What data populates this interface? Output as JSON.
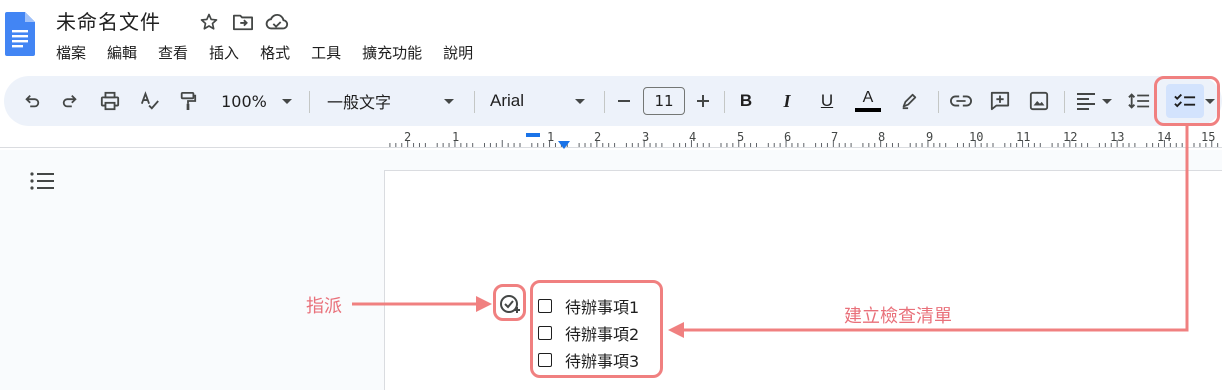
{
  "document": {
    "title": "未命名文件",
    "menu": [
      "檔案",
      "編輯",
      "查看",
      "插入",
      "格式",
      "工具",
      "擴充功能",
      "說明"
    ]
  },
  "toolbar": {
    "zoom": "100%",
    "paragraph_style": "一般文字",
    "font": "Arial",
    "font_size": "11",
    "bold_label": "B",
    "italic_label": "I",
    "underline_label": "U",
    "text_color_label": "A"
  },
  "ruler": {
    "labels": [
      "2",
      "1",
      "1",
      "2",
      "3",
      "4",
      "5",
      "6",
      "7",
      "8",
      "9",
      "10",
      "11",
      "12",
      "13",
      "14",
      "15"
    ]
  },
  "checklist": {
    "items": [
      "待辦事項1",
      "待辦事項2",
      "待辦事項3"
    ]
  },
  "annotations": {
    "assign_label": "指派",
    "create_checklist_label": "建立檢查清單",
    "color": "#f08080"
  }
}
